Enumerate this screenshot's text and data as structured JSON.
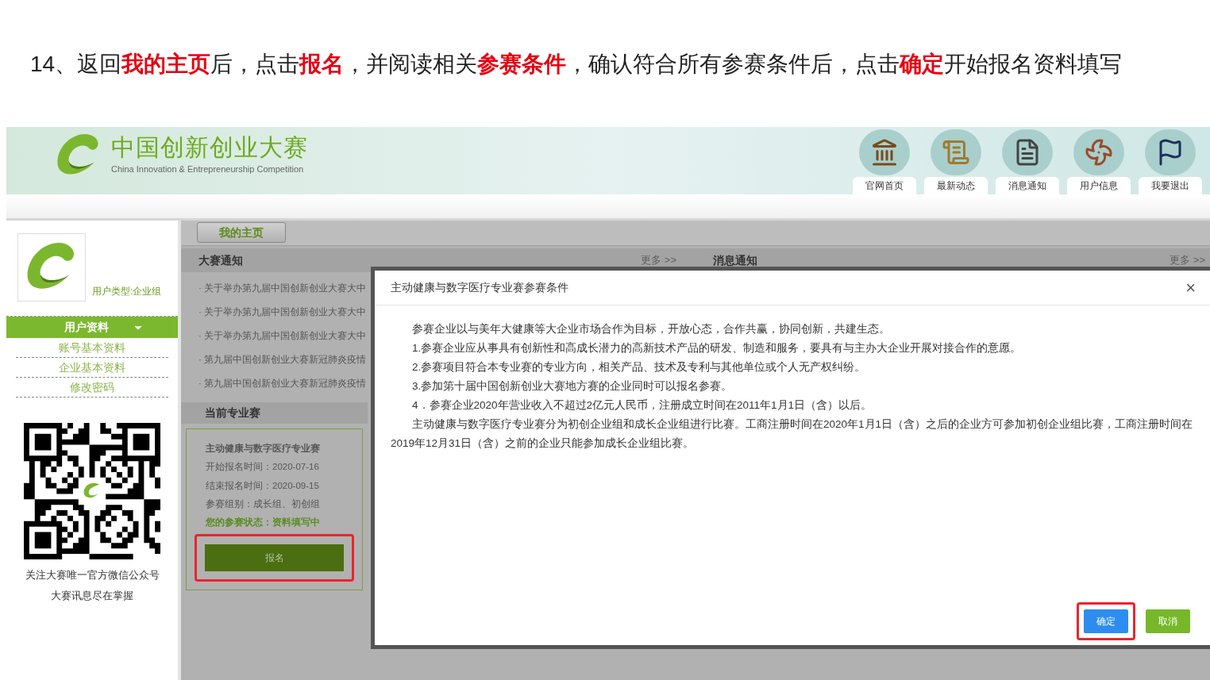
{
  "instruction": "14、返回**我的主页**后，点击**报名**，并阅读相关**参赛条件**，确认符合所有参赛条件后，点击**确定**开始报名资料填写",
  "header": {
    "title": "中国创新创业大赛",
    "subtitle": "China Innovation & Entrepreneurship Competition",
    "nav": [
      {
        "label": "官网首页",
        "kind": "home"
      },
      {
        "label": "最新动态",
        "kind": "news"
      },
      {
        "label": "消息通知",
        "kind": "messages"
      },
      {
        "label": "用户信息",
        "kind": "user"
      },
      {
        "label": "我要退出",
        "kind": "exit"
      }
    ]
  },
  "sidebar": {
    "user_type": "用户类型:企业组",
    "menu": {
      "title": "用户资料",
      "expanded": true,
      "items": [
        "账号基本资料",
        "企业基本资料",
        "修改密码"
      ]
    },
    "qr_caption": [
      "关注大赛唯一官方微信公众号",
      "大赛讯息尽在掌握"
    ]
  },
  "main": {
    "tab": "我的主页",
    "notices": {
      "title": "大赛通知",
      "more": "更多 >>",
      "items": [
        "· 关于举办第九届中国创新创业大赛大中",
        "· 关于举办第九届中国创新创业大赛大中",
        "· 关于举办第九届中国创新创业大赛大中",
        "· 第九届中国创新创业大赛新冠肺炎疫情",
        "· 第九届中国创新创业大赛新冠肺炎疫情"
      ]
    },
    "messages": {
      "title": "消息通知",
      "more": "更多 >>"
    },
    "current": {
      "title": "当前专业赛",
      "name": "主动健康与数字医疗专业赛",
      "lines": [
        "开始报名时间：2020-07-16",
        "结束报名时间：2020-09-15",
        "参赛组别：成长组、初创组"
      ],
      "status": "您的参赛状态：资料填写中",
      "button": {
        "label": "报名",
        "highlighted": true
      }
    }
  },
  "dialog": {
    "title": "主动健康与数字医疗专业赛参赛条件",
    "close": "×",
    "paragraphs": [
      "参赛企业以与美年大健康等大企业市场合作为目标，开放心态，合作共赢，协同创新，共建生态。",
      "1.参赛企业应从事具有创新性和高成长潜力的高新技术产品的研发、制造和服务，要具有与主办大企业开展对接合作的意愿。",
      "2.参赛项目符合本专业赛的专业方向，相关产品、技术及专利与其他单位或个人无产权纠纷。",
      "3.参加第十届中国创新创业大赛地方赛的企业同时可以报名参赛。",
      "4．参赛企业2020年营业收入不超过2亿元人民币，注册成立时间在2011年1月1日（含）以后。",
      "主动健康与数字医疗专业赛分为初创企业组和成长企业组进行比赛。工商注册时间在2020年1月1日（含）之后的企业方可参加初创企业组比赛，工商注册时间在2019年12月31日（含）之前的企业只能参加成长企业组比赛。"
    ],
    "buttons": [
      {
        "label": "确定",
        "kind": "primary",
        "highlighted": true
      },
      {
        "label": "取消",
        "kind": "secondary",
        "highlighted": false
      }
    ]
  }
}
